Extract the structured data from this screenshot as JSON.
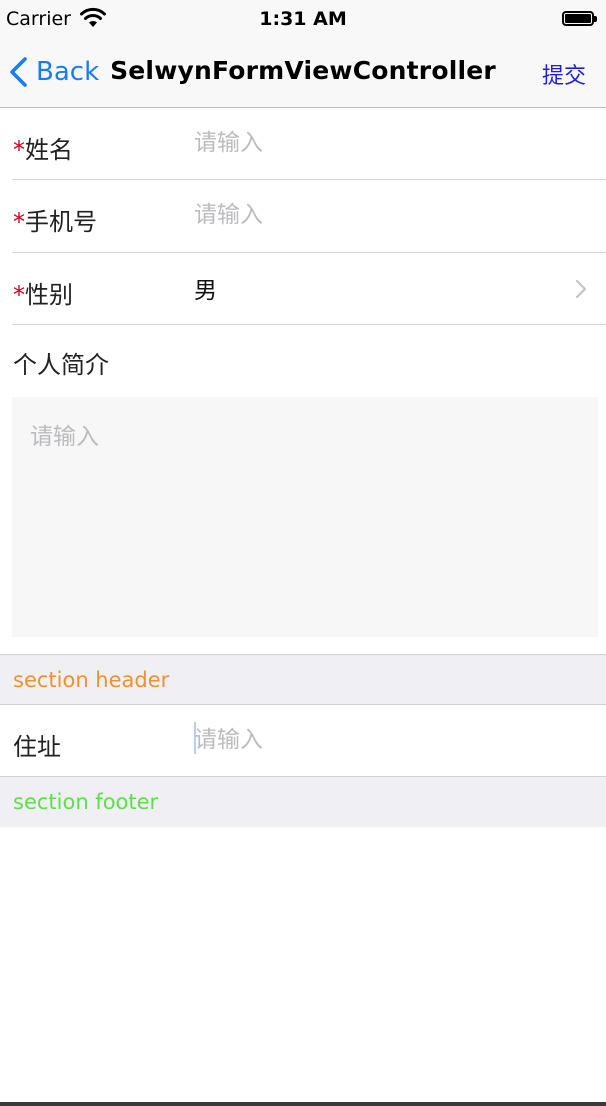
{
  "status_bar": {
    "carrier": "Carrier",
    "time": "1:31 AM"
  },
  "nav": {
    "back_label": "Back",
    "title": "SelwynFormViewController",
    "submit_label": "提交"
  },
  "form": {
    "required_mark": "*",
    "name": {
      "label": "姓名",
      "placeholder": "请输入",
      "value": ""
    },
    "phone": {
      "label": "手机号",
      "placeholder": "请输入",
      "value": ""
    },
    "gender": {
      "label": "性别",
      "value": "男"
    },
    "bio": {
      "label": "个人简介",
      "placeholder": "请输入",
      "value": ""
    },
    "address": {
      "label": "住址",
      "placeholder": "请输入",
      "value": ""
    }
  },
  "sections": {
    "header": {
      "text": "section header",
      "color": "#f0922e"
    },
    "footer": {
      "text": "section footer",
      "color": "#5ee04a"
    }
  },
  "colors": {
    "accent": "#1a7cf4",
    "required": "#d0021b",
    "placeholder": "#bcbcc0"
  }
}
